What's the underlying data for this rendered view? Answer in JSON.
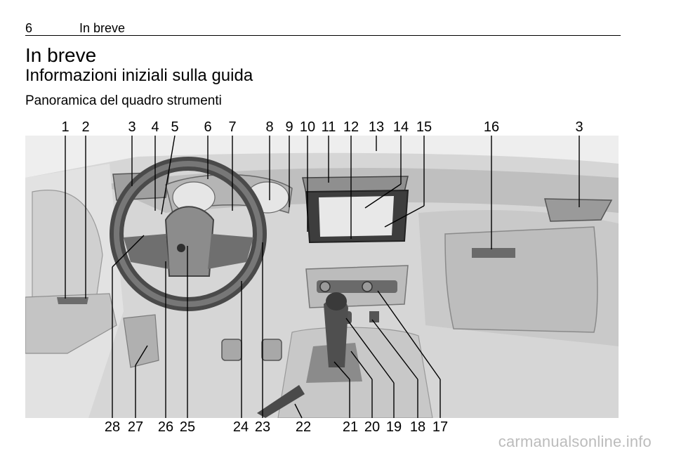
{
  "header": {
    "page_number": "6",
    "running_title": "In breve"
  },
  "chapter_title": "In breve",
  "section_title": "Informazioni iniziali sulla guida",
  "subsection_title": "Panoramica del quadro strumenti",
  "figure": {
    "top_callouts": [
      "1",
      "2",
      "3",
      "4",
      "5",
      "6",
      "7",
      "8",
      "9",
      "10",
      "11",
      "12",
      "13",
      "14",
      "15",
      "16",
      "3"
    ],
    "bottom_callouts": [
      "28",
      "27",
      "26",
      "25",
      "24",
      "23",
      "22",
      "21",
      "20",
      "19",
      "18",
      "17"
    ]
  },
  "watermark": "carmanualsonline.info"
}
